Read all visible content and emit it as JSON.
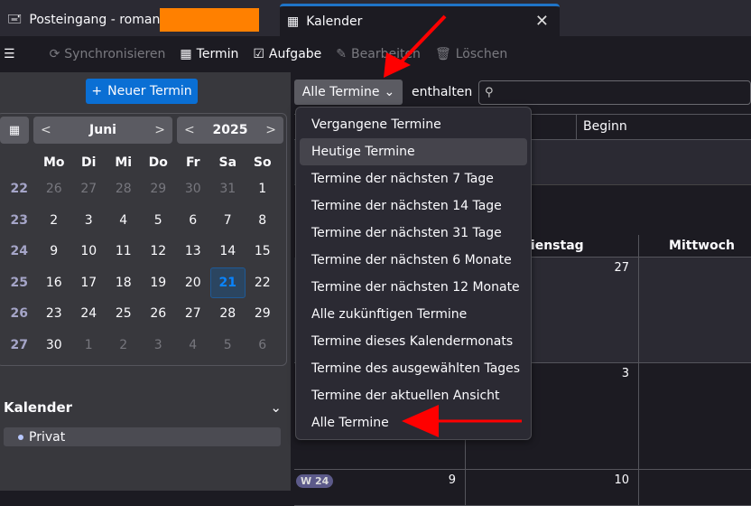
{
  "tabs": [
    {
      "label": "Posteingang - roman",
      "icon": "inbox-icon"
    },
    {
      "label": "Kalender",
      "icon": "calendar-icon",
      "active": true
    }
  ],
  "toolbar": {
    "sync": "Synchronisieren",
    "event": "Termin",
    "task": "Aufgabe",
    "edit": "Bearbeiten",
    "delete": "Löschen"
  },
  "sidebar": {
    "new_event": "Neuer Termin",
    "month": "Juni",
    "year": "2025",
    "weekdays": [
      "Mo",
      "Di",
      "Mi",
      "Do",
      "Fr",
      "Sa",
      "So"
    ],
    "weeks": [
      {
        "wk": "22",
        "days": [
          "26",
          "27",
          "28",
          "29",
          "30",
          "31",
          "1"
        ]
      },
      {
        "wk": "23",
        "days": [
          "2",
          "3",
          "4",
          "5",
          "6",
          "7",
          "8"
        ]
      },
      {
        "wk": "24",
        "days": [
          "9",
          "10",
          "11",
          "12",
          "13",
          "14",
          "15"
        ]
      },
      {
        "wk": "25",
        "days": [
          "16",
          "17",
          "18",
          "19",
          "20",
          "21",
          "22"
        ]
      },
      {
        "wk": "26",
        "days": [
          "23",
          "24",
          "25",
          "26",
          "27",
          "28",
          "29"
        ]
      },
      {
        "wk": "27",
        "days": [
          "30",
          "1",
          "2",
          "3",
          "4",
          "5",
          "6"
        ]
      }
    ],
    "selected_day": "21",
    "calendars_title": "Kalender",
    "calendars": [
      "Privat"
    ]
  },
  "filter": {
    "selected": "Alle Termine",
    "contains": "enthalten",
    "search_placeholder": "",
    "options": [
      "Vergangene Termine",
      "Heutige Termine",
      "Termine der nächsten 7 Tage",
      "Termine der nächsten 14 Tage",
      "Termine der nächsten 31 Tage",
      "Termine der nächsten 6 Monate",
      "Termine der nächsten 12 Monate",
      "Alle zukünftigen Termine",
      "Termine dieses Kalendermonats",
      "Termine des ausgewählten Tages",
      "Termine der aktuellen Ansicht",
      "Alle Termine"
    ],
    "highlighted": "Heutige Termine"
  },
  "list": {
    "columns": [
      "Beginn"
    ]
  },
  "month_view": {
    "headers": [
      "Dienstag",
      "Mittwoch"
    ],
    "week_badge": "W 24",
    "days": [
      "27",
      "3",
      "9",
      "10"
    ]
  },
  "colors": {
    "accent": "#0a6fd4",
    "annotation": "#ff0000",
    "redaction": "#ff8000"
  }
}
